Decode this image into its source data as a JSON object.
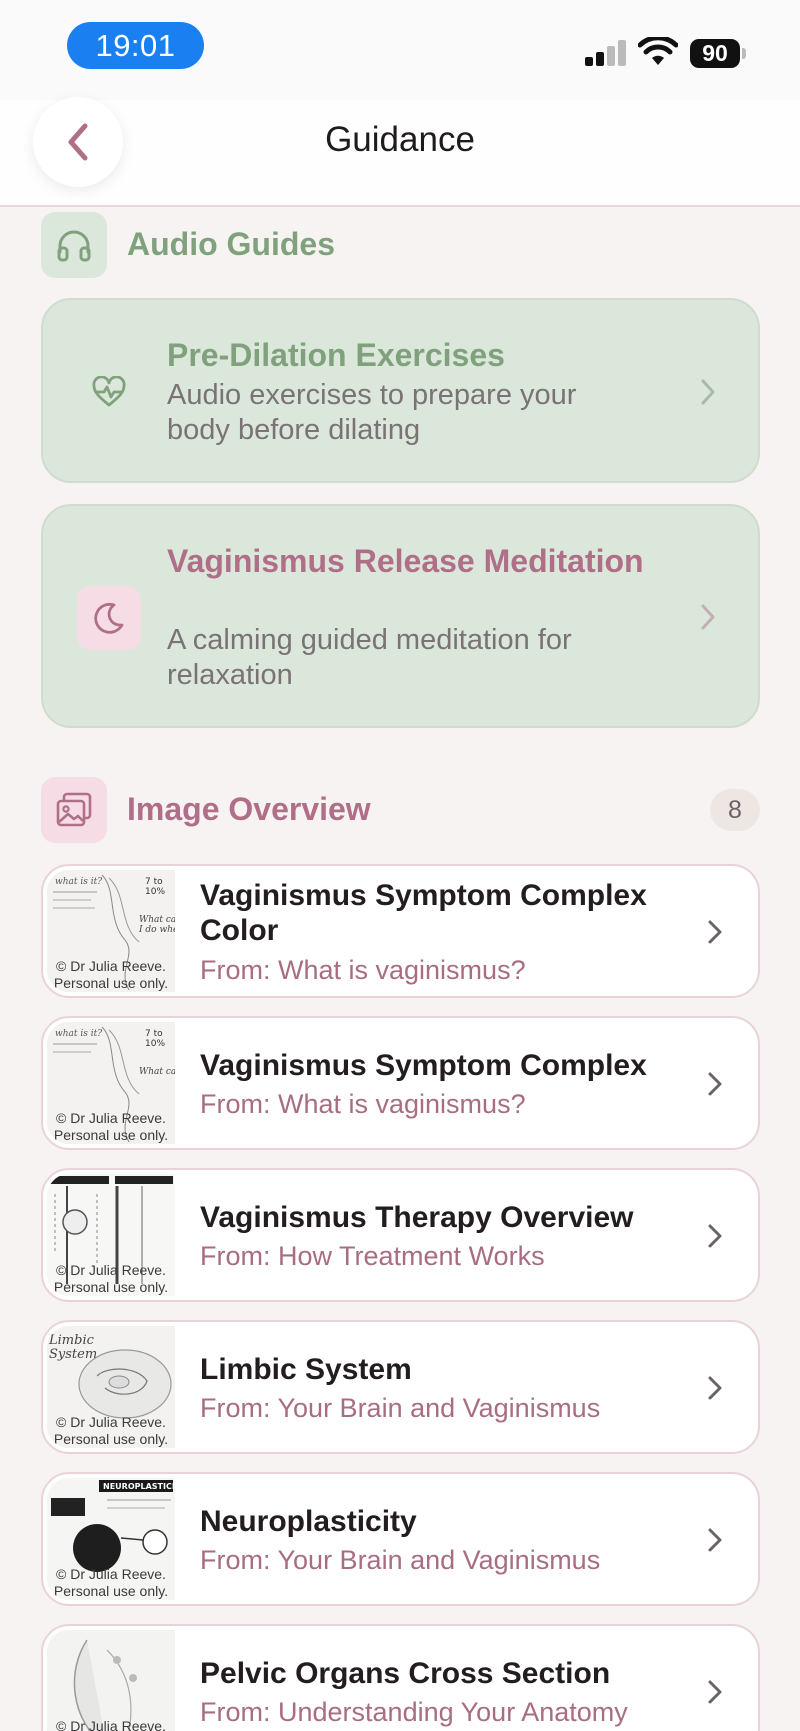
{
  "status_bar": {
    "time": "19:01",
    "battery": "90"
  },
  "header": {
    "title": "Guidance"
  },
  "audio_section": {
    "title": "Audio Guides",
    "items": [
      {
        "title": "Pre-Dilation Exercises",
        "description": "Audio exercises to prepare your body before dilating",
        "icon": "heart-pulse-icon"
      },
      {
        "title": "Vaginismus Release Meditation",
        "description": "A calming guided meditation for relaxation",
        "icon": "moon-icon"
      }
    ]
  },
  "image_section": {
    "title": "Image Overview",
    "count": "8",
    "watermark": "© Dr Julia Reeve. Personal use only.",
    "items": [
      {
        "title": "Vaginismus Symptom Complex Color",
        "source": "From: What is vaginismus?"
      },
      {
        "title": "Vaginismus Symptom Complex",
        "source": "From: What is vaginismus?"
      },
      {
        "title": "Vaginismus Therapy Overview",
        "source": "From: How Treatment Works"
      },
      {
        "title": "Limbic System",
        "source": "From: Your Brain and Vaginismus"
      },
      {
        "title": "Neuroplasticity",
        "source": "From: Your Brain and Vaginismus"
      },
      {
        "title": "Pelvic Organs Cross Section",
        "source": "From: Understanding Your Anatomy"
      }
    ]
  },
  "colors": {
    "green_accent": "#7fa27c",
    "pink_accent": "#b06f88",
    "card_green": "#dce7db",
    "pink_tile": "#f6dde5",
    "green_tile": "#dce7db"
  }
}
